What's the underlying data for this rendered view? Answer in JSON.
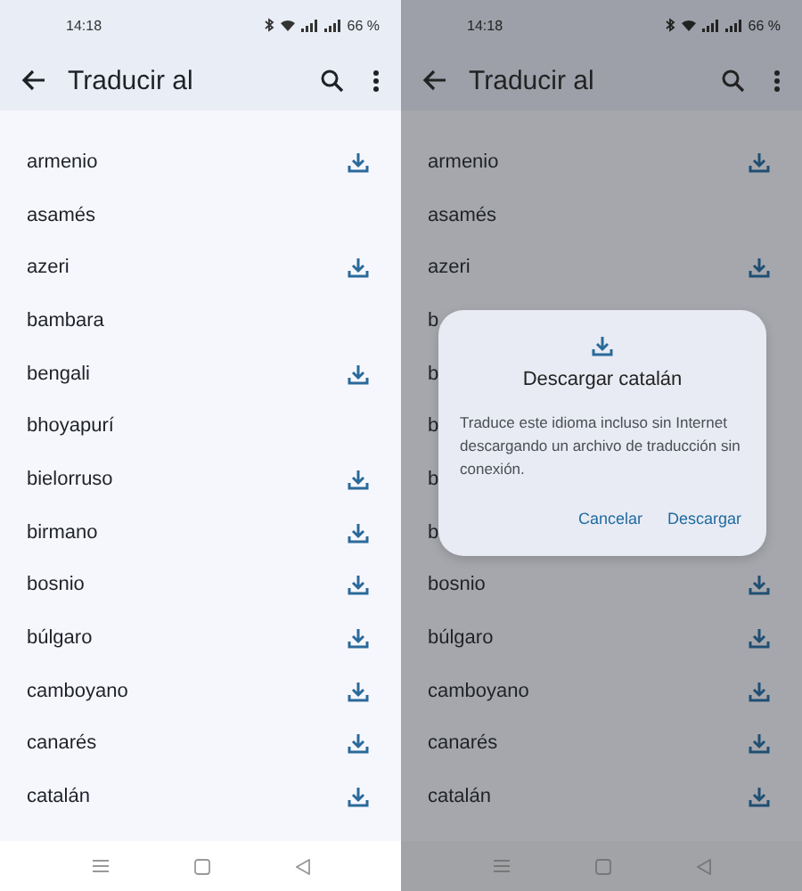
{
  "panels": [
    {
      "dimmed": false,
      "status_bar": {
        "time": "14:18",
        "battery": "66 %"
      },
      "app_bar": {
        "title": "Traducir al"
      },
      "rows": [
        {
          "name": "armenio",
          "downloadable": true
        },
        {
          "name": "asamés",
          "downloadable": false
        },
        {
          "name": "azeri",
          "downloadable": true
        },
        {
          "name": "bambara",
          "downloadable": false
        },
        {
          "name": "bengali",
          "downloadable": true
        },
        {
          "name": "bhoyapurí",
          "downloadable": false
        },
        {
          "name": "bielorruso",
          "downloadable": true
        },
        {
          "name": "birmano",
          "downloadable": true
        },
        {
          "name": "bosnio",
          "downloadable": true
        },
        {
          "name": "búlgaro",
          "downloadable": true
        },
        {
          "name": "camboyano",
          "downloadable": true
        },
        {
          "name": "canarés",
          "downloadable": true
        },
        {
          "name": "catalán",
          "downloadable": true
        }
      ]
    },
    {
      "dimmed": true,
      "status_bar": {
        "time": "14:18",
        "battery": "66 %"
      },
      "app_bar": {
        "title": "Traducir al"
      },
      "rows": [
        {
          "name": "armenio",
          "downloadable": true
        },
        {
          "name": "asamés",
          "downloadable": false
        },
        {
          "name": "azeri",
          "downloadable": true
        },
        {
          "name": "b"
        },
        {
          "name": "b"
        },
        {
          "name": "b"
        },
        {
          "name": "b"
        },
        {
          "name": "b"
        },
        {
          "name": "bosnio",
          "downloadable": true
        },
        {
          "name": "búlgaro",
          "downloadable": true
        },
        {
          "name": "camboyano",
          "downloadable": true
        },
        {
          "name": "canarés",
          "downloadable": true
        },
        {
          "name": "catalán",
          "downloadable": true
        }
      ],
      "dialog": {
        "title": "Descargar catalán",
        "message": "Traduce este idioma incluso sin Internet descargando un archivo de traducción sin conexión.",
        "buttons": [
          "Cancelar",
          "Descargar"
        ]
      }
    }
  ]
}
